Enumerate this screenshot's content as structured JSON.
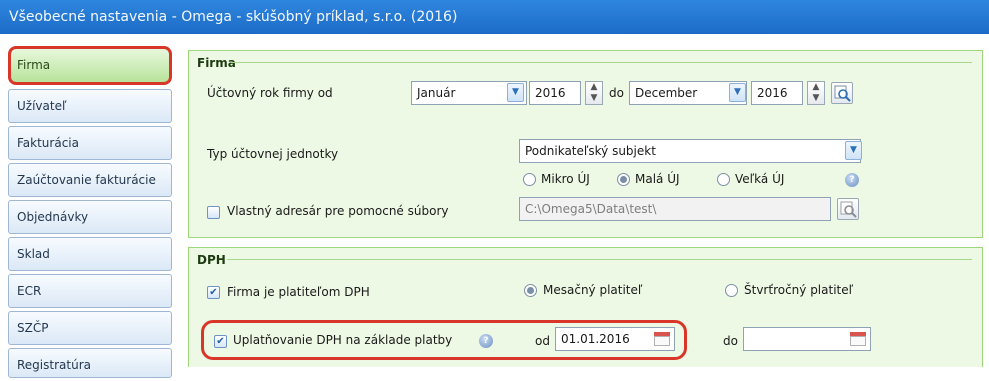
{
  "window": {
    "title": "Všeobecné nastavenia - Omega - skúšobný príklad, s.r.o. (2016)"
  },
  "sidebar": {
    "items": [
      {
        "label": "Firma",
        "active": true
      },
      {
        "label": "Užívateľ"
      },
      {
        "label": "Fakturácia"
      },
      {
        "label": "Zaúčtovanie fakturácie"
      },
      {
        "label": "Objednávky"
      },
      {
        "label": "Sklad"
      },
      {
        "label": "ECR"
      },
      {
        "label": "SZČP"
      },
      {
        "label": "Registratúra"
      }
    ]
  },
  "firma": {
    "section_title": "Firma",
    "fiscal_year_label": "Účtovný rok firmy od",
    "from_month": "Január",
    "from_year": "2016",
    "to_label": "do",
    "to_month": "December",
    "to_year": "2016",
    "unit_type_label": "Typ účtovnej jednotky",
    "unit_type_value": "Podnikateľský subjekt",
    "size_options": [
      {
        "label": "Mikro ÚJ",
        "selected": false
      },
      {
        "label": "Malá ÚJ",
        "selected": true
      },
      {
        "label": "Veľká ÚJ",
        "selected": false
      }
    ],
    "own_dir_label": "Vlastný adresár pre pomocné súbory",
    "own_dir_checked": false,
    "own_dir_path": "C:\\Omega5\\Data\\test\\"
  },
  "dph": {
    "section_title": "DPH",
    "payer_label": "Firma je platiteľom DPH",
    "payer_checked": true,
    "monthly_label": "Mesačný platiteľ",
    "monthly_selected": true,
    "quarterly_label": "Štvrťročný platiteľ",
    "quarterly_selected": false,
    "cash_basis_label": "Uplatňovanie DPH na základe platby",
    "cash_basis_checked": true,
    "from_label": "od",
    "from_date": "01.01.2016",
    "to_label": "do",
    "to_date": ""
  },
  "colors": {
    "titlebar": "#1c6cc7",
    "panel": "#eef9e5",
    "highlight": "#d9362a",
    "active_tab": "#b8e39b"
  }
}
